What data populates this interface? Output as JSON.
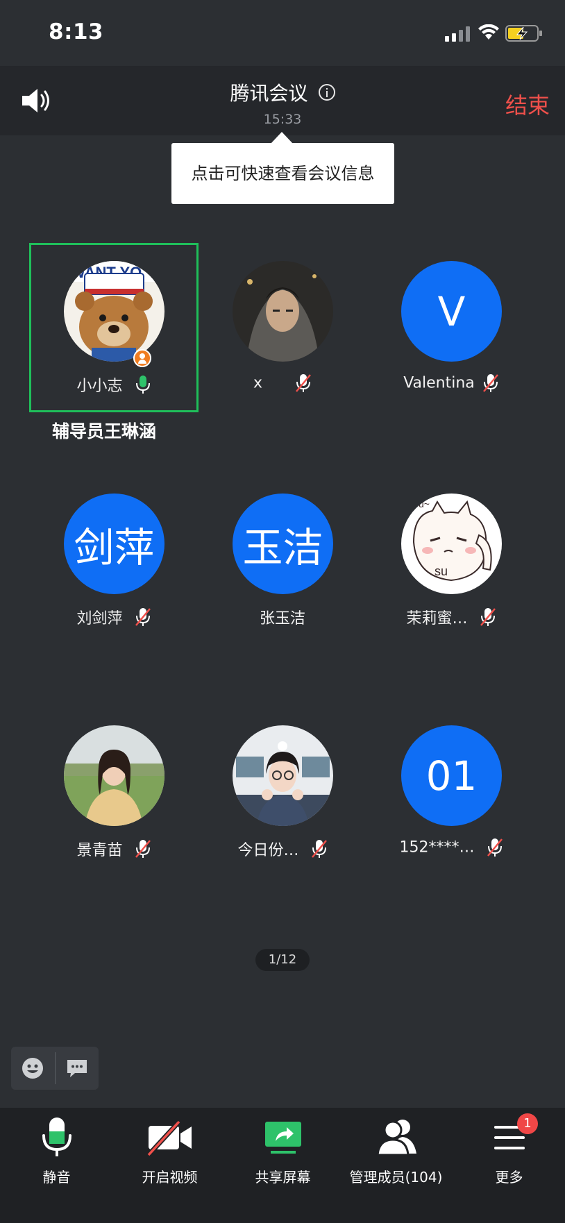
{
  "status_bar": {
    "time": "8:13"
  },
  "header": {
    "title": "腾讯会议",
    "elapsed": "15:33",
    "end_label": "结束"
  },
  "tooltip": {
    "text": "点击可快速查看会议信息"
  },
  "active_speaker": {
    "name": "辅导员王琳涵"
  },
  "participants": [
    {
      "name": "小小志",
      "avatar_type": "photo-teddy-bear",
      "mic": "on",
      "host": true
    },
    {
      "name": "x",
      "avatar_type": "photo-person-hood",
      "mic": "muted"
    },
    {
      "name": "Valentina",
      "avatar_text": "V",
      "avatar_color": "#0f6ef5",
      "mic": "muted"
    },
    {
      "name": "刘剑萍",
      "avatar_text": "剑萍",
      "avatar_color": "#0f6ef5",
      "mic": "muted"
    },
    {
      "name": "张玉洁",
      "avatar_text": "玉洁",
      "avatar_color": "#0f6ef5",
      "mic": "none"
    },
    {
      "name": "茉莉蜜…",
      "avatar_type": "cartoon-cat",
      "mic": "muted"
    },
    {
      "name": "景青苗",
      "avatar_type": "photo-woman-grass",
      "mic": "muted"
    },
    {
      "name": "今日份…",
      "avatar_type": "photo-girl-glasses",
      "mic": "muted"
    },
    {
      "name": "152****…",
      "avatar_text": "01",
      "avatar_color": "#0f6ef5",
      "mic": "muted"
    }
  ],
  "page_indicator": "1/12",
  "toolbar": {
    "mute_label": "静音",
    "video_label": "开启视频",
    "share_label": "共享屏幕",
    "members_label": "管理成员(104)",
    "more_label": "更多",
    "more_badge": "1"
  },
  "colors": {
    "background": "#2c2f33",
    "header": "#25272b",
    "accent_blue": "#0f6ef5",
    "active_border": "#1fbf5a",
    "end_red": "#f0504b",
    "mic_green": "#2ec26a"
  }
}
